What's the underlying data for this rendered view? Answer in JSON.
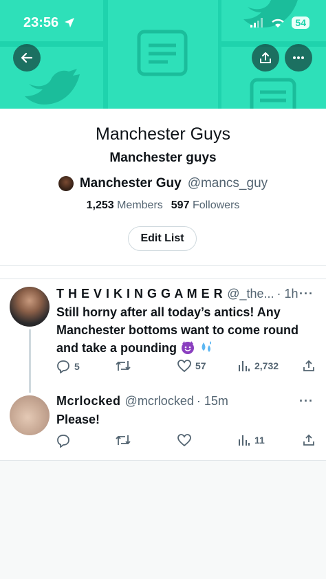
{
  "status_bar": {
    "time": "23:56",
    "battery": "54"
  },
  "list": {
    "title": "Manchester Guys",
    "subtitle": "Manchester guys",
    "owner_name": "Manchester Guy",
    "owner_handle": "@mancs_guy",
    "members_count": "1,253",
    "members_label": "Members",
    "followers_count": "597",
    "followers_label": "Followers",
    "edit_button": "Edit List"
  },
  "tweets": [
    {
      "display_name": "T H E V I K I N G G A M E R",
      "handle": "@_the...",
      "time": "· 1h",
      "more": "···",
      "text": "Still horny after all today’s antics! Any Manchester bottoms want to come round and take a pounding",
      "replies": "5",
      "likes": "57",
      "views": "2,732"
    },
    {
      "display_name": "Mcrlocked",
      "handle": "@mcrlocked",
      "time": "· 15m",
      "more": "···",
      "text": "Please!",
      "views": "11"
    }
  ],
  "icons": [
    "back-arrow-icon",
    "share-icon",
    "more-icon",
    "reply-icon",
    "retweet-icon",
    "like-icon",
    "views-icon",
    "share-icon"
  ],
  "colors": {
    "banner": "#1fd3ad",
    "text": "#0f1419",
    "muted": "#536471"
  }
}
